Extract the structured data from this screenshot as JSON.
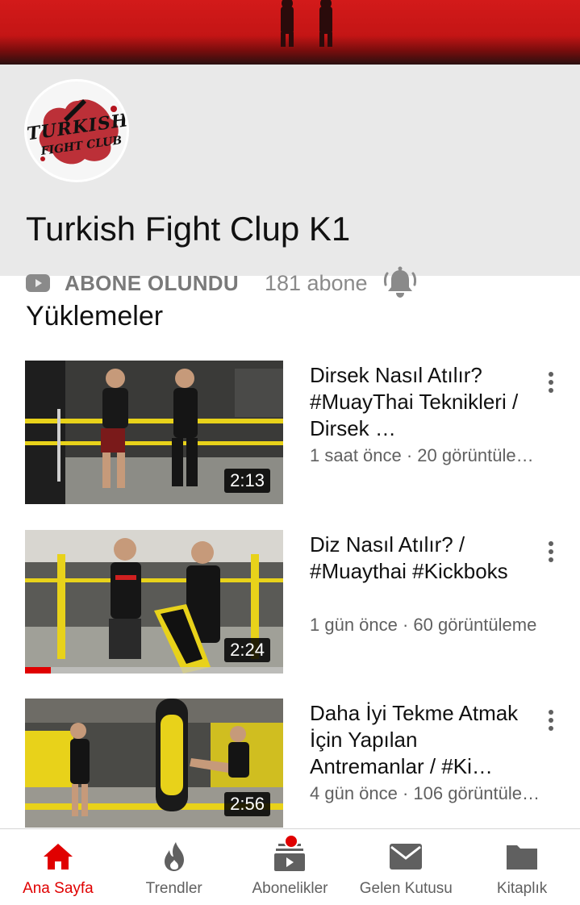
{
  "channel": {
    "name": "Turkish Fight Clup K1",
    "logo_text_line1": "TURKISH",
    "logo_text_line2": "FIGHT CLUB",
    "subscribe_label": "ABONE OLUNDU",
    "subscriber_count": "181 abone"
  },
  "uploads": {
    "section_title": "Yüklemeler",
    "videos": [
      {
        "title": "Dirsek Nasıl Atılır? #MuayThai Teknikleri / Dirsek …",
        "meta": "1 saat önce · 20 görüntüle…",
        "duration": "2:13",
        "watched_fraction": 0.0
      },
      {
        "title": "Diz Nasıl Atılır? / #Muaythai #Kickboks",
        "meta": "1 gün önce · 60 görüntüleme",
        "duration": "2:24",
        "watched_fraction": 0.1
      },
      {
        "title": "Daha İyi Tekme Atmak İçin Yapılan Antremanlar / #Ki…",
        "meta": "4 gün önce · 106 görüntüle…",
        "duration": "2:56",
        "watched_fraction": 0.0
      }
    ]
  },
  "bottom_nav": {
    "items": [
      {
        "label": "Ana Sayfa",
        "icon": "home-icon",
        "active": true
      },
      {
        "label": "Trendler",
        "icon": "flame-icon",
        "active": false
      },
      {
        "label": "Abonelikler",
        "icon": "subscriptions-icon",
        "active": false,
        "badge": true
      },
      {
        "label": "Gelen Kutusu",
        "icon": "inbox-icon",
        "active": false
      },
      {
        "label": "Kitaplık",
        "icon": "library-icon",
        "active": false
      }
    ]
  },
  "colors": {
    "accent": "#e00000",
    "banner": "#d31a1a",
    "header_bg": "#e9e9e9"
  }
}
